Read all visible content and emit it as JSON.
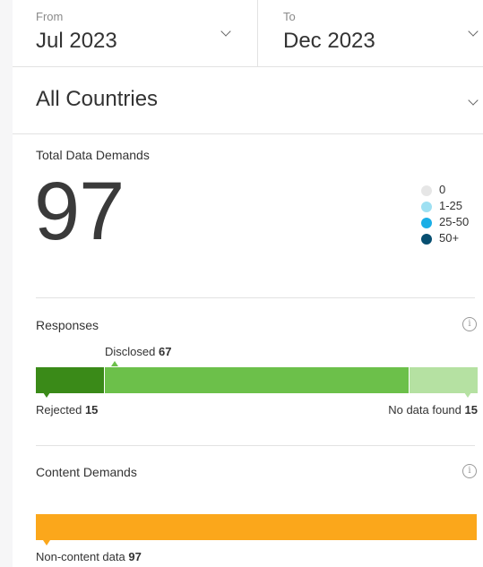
{
  "date_range": {
    "from": {
      "label": "From",
      "value": "Jul 2023"
    },
    "to": {
      "label": "To",
      "value": "Dec 2023"
    }
  },
  "country_filter": {
    "value": "All Countries"
  },
  "total": {
    "title": "Total Data Demands",
    "value": "97",
    "legend": [
      {
        "label": "0",
        "color": "#e6e6e6"
      },
      {
        "label": "1-25",
        "color": "#9ee0f2"
      },
      {
        "label": "25-50",
        "color": "#1aaee6"
      },
      {
        "label": "50+",
        "color": "#074f71"
      }
    ]
  },
  "responses": {
    "title": "Responses",
    "segments": [
      {
        "name": "Rejected",
        "value": 15,
        "value_text": "15",
        "color": "#3a8a18"
      },
      {
        "name": "Disclosed",
        "value": 67,
        "value_text": "67",
        "color": "#6cc04a"
      },
      {
        "name": "No data found",
        "value": 15,
        "value_text": "15",
        "color": "#b5e1a2"
      }
    ]
  },
  "content_demands": {
    "title": "Content Demands",
    "segments": [
      {
        "name": "Non-content data",
        "value": 97,
        "value_text": "97",
        "color": "#fba71b"
      }
    ]
  },
  "icons": {
    "info": "i",
    "info_name": "info-icon",
    "chevron_name": "chevron-down-icon"
  }
}
